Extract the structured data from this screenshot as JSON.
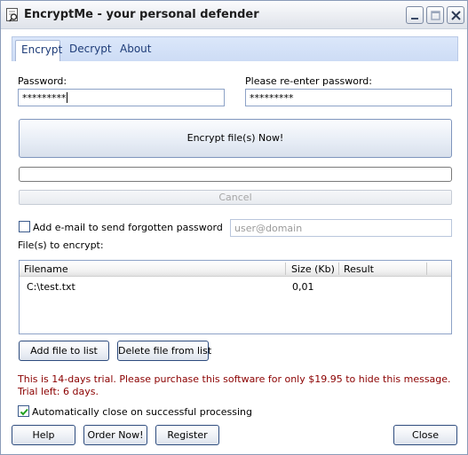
{
  "window": {
    "title": "EncryptMe - your personal defender"
  },
  "tabs": [
    {
      "label": "Encrypt",
      "active": true
    },
    {
      "label": "Decrypt",
      "active": false
    },
    {
      "label": "About",
      "active": false
    }
  ],
  "password": {
    "label": "Password:",
    "value": "*********"
  },
  "reenter": {
    "label": "Please re-enter password:",
    "value": "*********"
  },
  "encrypt_button": "Encrypt file(s) Now!",
  "progress": 0,
  "cancel_button": "Cancel",
  "email": {
    "checkbox_label": "Add e-mail to send forgotten password",
    "checked": false,
    "placeholder": "user@domain"
  },
  "files": {
    "label": "File(s) to encrypt:",
    "columns": [
      "Filename",
      "Size (Kb)",
      "Result"
    ],
    "rows": [
      {
        "filename": "C:\\test.txt",
        "size": "0,01",
        "result": ""
      }
    ]
  },
  "add_file_button": "Add file to list",
  "delete_file_button": "Delete file from list",
  "trial_message": "This is 14-days trial. Please purchase this software for only $19.95 to hide this message. Trial left: 6 days.",
  "auto_close": {
    "label": "Automatically close on successful processing",
    "checked": true
  },
  "footer": {
    "help": "Help",
    "order": "Order Now!",
    "register": "Register",
    "close": "Close"
  },
  "colors": {
    "trial_text": "#8b0000",
    "tab_text": "#1e3c78",
    "check_mark": "#21a121"
  }
}
